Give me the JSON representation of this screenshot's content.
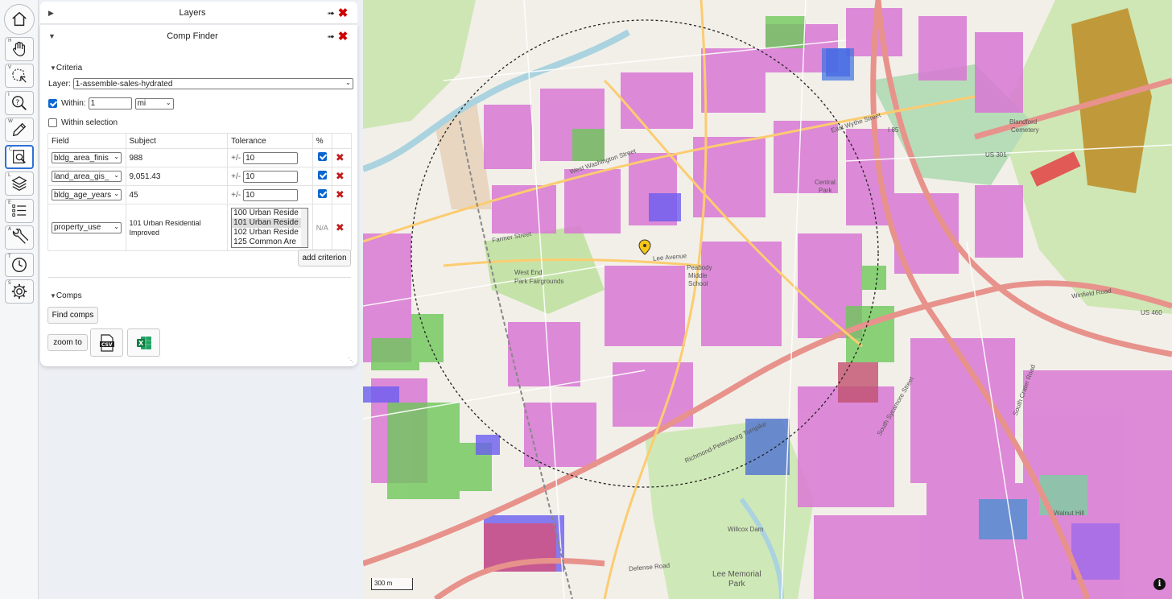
{
  "toolbar": {
    "tools": [
      {
        "icon": "home-icon",
        "key": ""
      },
      {
        "icon": "pan-hand-icon",
        "key": "H"
      },
      {
        "icon": "select-area-icon",
        "key": "V"
      },
      {
        "icon": "identify-icon",
        "key": "I"
      },
      {
        "icon": "pencil-icon",
        "key": "W"
      },
      {
        "icon": "comp-finder-icon",
        "key": "C"
      },
      {
        "icon": "layers-icon",
        "key": "L"
      },
      {
        "icon": "legend-list-icon",
        "key": "E"
      },
      {
        "icon": "wrench-icon",
        "key": "A"
      },
      {
        "icon": "clock-icon",
        "key": "T"
      },
      {
        "icon": "gear-icon",
        "key": "S"
      }
    ]
  },
  "layers_panel": {
    "title": "Layers"
  },
  "comp_finder": {
    "title": "Comp Finder",
    "criteria_heading": "Criteria",
    "layer_label": "Layer:",
    "layer_value": "1-assemble-sales-hydrated",
    "within_label": "Within:",
    "within_checked": true,
    "within_value": "1",
    "within_unit": "mi",
    "within_selection_label": "Within selection",
    "within_selection_checked": false,
    "table_headers": {
      "field": "Field",
      "subject": "Subject",
      "tolerance": "Tolerance",
      "percent": "%"
    },
    "rows": [
      {
        "field": "bldg_area_finis",
        "subject": "988",
        "prefix": "+/-",
        "tolerance": "10",
        "percent": true
      },
      {
        "field": "land_area_gis_",
        "subject": "9,051.43",
        "prefix": "+/-",
        "tolerance": "10",
        "percent": true
      },
      {
        "field": "bldg_age_years",
        "subject": "45",
        "prefix": "+/-",
        "tolerance": "10",
        "percent": true
      }
    ],
    "use_row": {
      "field": "property_use",
      "subject_line1": "101 Urban Residential",
      "subject_line2": "Improved",
      "options": [
        "100 Urban Reside",
        "101 Urban Reside",
        "102 Urban Reside",
        "125 Common Are"
      ],
      "selected_index": 1,
      "percent": "N/A"
    },
    "add_criterion": "add criterion",
    "comps_heading": "Comps",
    "find_comps": "Find comps",
    "zoom_to": "zoom to",
    "csv_icon": "csv-file-icon",
    "excel_icon": "excel-file-icon"
  },
  "map": {
    "scale_label": "300 m",
    "info_glyph": "i",
    "labels": {
      "west_end_park": "West End",
      "west_end_park2": "Park Fairgrounds",
      "lee_memorial": "Lee Memorial",
      "lee_memorial2": "Park",
      "blandford": "Blandford",
      "blandford2": "Cemetery",
      "central_park": "Central",
      "central_park2": "Park",
      "peabody": "Peabody",
      "peabody2": "Middle",
      "peabody3": "School",
      "willcox": "Willcox Dam",
      "walnut_hill": "Walnut Hill",
      "wythe": "East Wythe Street",
      "washington": "West Washington Street",
      "us301": "US 301",
      "us460": "US 460",
      "i85": "I 85",
      "turnpike": "Richmond-Petersburg Turnpike",
      "winfield": "Winfield Road",
      "crater": "South Crater Road",
      "sycamore": "South Sycamore Street",
      "defense": "Defense Road",
      "farmer": "Farmer Street",
      "lee_ave": "Lee Avenue"
    }
  }
}
